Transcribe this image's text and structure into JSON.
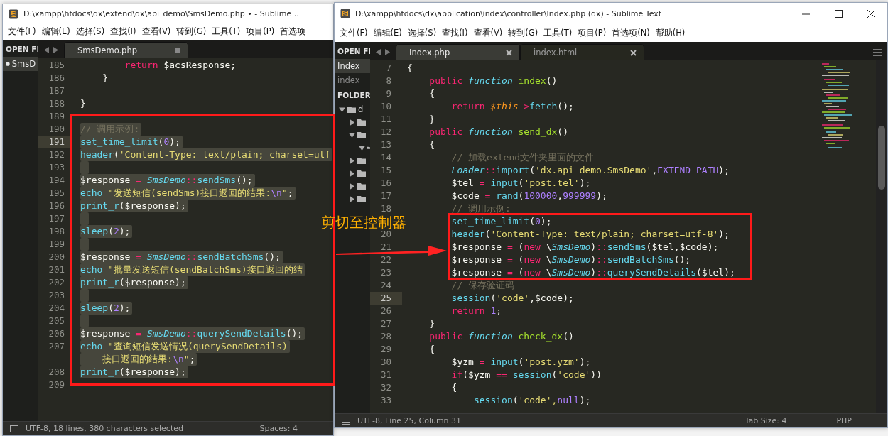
{
  "windows": [
    {
      "title": "D:\\xampp\\htdocs\\dx\\extend\\dx\\api_demo\\SmsDemo.php • - Sublime ...",
      "window_controls": false,
      "minimap": false,
      "menu": [
        "文件(F)",
        "编辑(E)",
        "选择(S)",
        "查找(I)",
        "查看(V)",
        "转到(G)",
        "工具(T)",
        "项目(P)",
        "首选项"
      ],
      "open_files": {
        "header": "OPEN FI",
        "items": [
          {
            "label": "SmsD",
            "selected": true,
            "dirty": true
          }
        ]
      },
      "tabs": [
        {
          "label": "SmsDemo.php",
          "selected": true,
          "dirty": true
        }
      ],
      "lines": [
        {
          "number": "185",
          "current": false,
          "selected": false,
          "tokens": [
            {
              "text": "        return ",
              "kind": "k"
            },
            {
              "text": "$acsResponse;",
              "kind": "p"
            }
          ]
        },
        {
          "number": "186",
          "current": false,
          "selected": false,
          "tokens": [
            {
              "text": "    }",
              "kind": "p"
            }
          ]
        },
        {
          "number": "187",
          "current": false,
          "selected": false
        },
        {
          "number": "188",
          "current": false,
          "selected": false,
          "tokens": [
            {
              "text": "}",
              "kind": "p"
            }
          ]
        },
        {
          "number": "189",
          "current": false,
          "selected": false
        },
        {
          "number": "190",
          "current": false,
          "selected": true,
          "tokens": [
            {
              "text": "// 调用示例:",
              "kind": "cm"
            }
          ]
        },
        {
          "number": "191",
          "current": true,
          "selected": true,
          "tokens": [
            {
              "text": "set_time_limit",
              "kind": "b"
            },
            {
              "text": "(",
              "kind": "p"
            },
            {
              "text": "0",
              "kind": "n"
            },
            {
              "text": ");",
              "kind": "p"
            }
          ]
        },
        {
          "number": "192",
          "current": false,
          "selected": true,
          "tokens": [
            {
              "text": "header",
              "kind": "b"
            },
            {
              "text": "(",
              "kind": "p"
            },
            {
              "text": "'Content-Type: text/plain; charset=utf",
              "kind": "st"
            }
          ]
        },
        {
          "number": "193",
          "current": false,
          "selected": true
        },
        {
          "number": "194",
          "current": false,
          "selected": true,
          "tokens": [
            {
              "text": "$response ",
              "kind": "p"
            },
            {
              "text": "= ",
              "kind": "o"
            },
            {
              "text": "SmsDemo",
              "kind": "c"
            },
            {
              "text": "::",
              "kind": "o"
            },
            {
              "text": "sendSms",
              "kind": "b"
            },
            {
              "text": "();",
              "kind": "p"
            }
          ]
        },
        {
          "number": "195",
          "current": false,
          "selected": true,
          "tokens": [
            {
              "text": "echo ",
              "kind": "b"
            },
            {
              "text": "\"发送短信(sendSms)接口返回的结果:",
              "kind": "st"
            },
            {
              "text": "\\n",
              "kind": "n"
            },
            {
              "text": "\"",
              "kind": "st"
            },
            {
              "text": ";",
              "kind": "p"
            }
          ]
        },
        {
          "number": "196",
          "current": false,
          "selected": true,
          "tokens": [
            {
              "text": "print_r",
              "kind": "b"
            },
            {
              "text": "($response);",
              "kind": "p"
            }
          ]
        },
        {
          "number": "197",
          "current": false,
          "selected": true
        },
        {
          "number": "198",
          "current": false,
          "selected": true,
          "tokens": [
            {
              "text": "sleep",
              "kind": "b"
            },
            {
              "text": "(",
              "kind": "p"
            },
            {
              "text": "2",
              "kind": "n"
            },
            {
              "text": ");",
              "kind": "p"
            }
          ]
        },
        {
          "number": "199",
          "current": false,
          "selected": true
        },
        {
          "number": "200",
          "current": false,
          "selected": true,
          "tokens": [
            {
              "text": "$response ",
              "kind": "p"
            },
            {
              "text": "= ",
              "kind": "o"
            },
            {
              "text": "SmsDemo",
              "kind": "c"
            },
            {
              "text": "::",
              "kind": "o"
            },
            {
              "text": "sendBatchSms",
              "kind": "b"
            },
            {
              "text": "();",
              "kind": "p"
            }
          ]
        },
        {
          "number": "201",
          "current": false,
          "selected": true,
          "tokens": [
            {
              "text": "echo ",
              "kind": "b"
            },
            {
              "text": "\"批量发送短信(sendBatchSms)接口返回的结",
              "kind": "st"
            }
          ]
        },
        {
          "number": "202",
          "current": false,
          "selected": true,
          "tokens": [
            {
              "text": "print_r",
              "kind": "b"
            },
            {
              "text": "($response);",
              "kind": "p"
            }
          ]
        },
        {
          "number": "203",
          "current": false,
          "selected": true
        },
        {
          "number": "204",
          "current": false,
          "selected": true,
          "tokens": [
            {
              "text": "sleep",
              "kind": "b"
            },
            {
              "text": "(",
              "kind": "p"
            },
            {
              "text": "2",
              "kind": "n"
            },
            {
              "text": ");",
              "kind": "p"
            }
          ]
        },
        {
          "number": "205",
          "current": false,
          "selected": true
        },
        {
          "number": "206",
          "current": false,
          "selected": true,
          "tokens": [
            {
              "text": "$response ",
              "kind": "p"
            },
            {
              "text": "= ",
              "kind": "o"
            },
            {
              "text": "SmsDemo",
              "kind": "c"
            },
            {
              "text": "::",
              "kind": "o"
            },
            {
              "text": "querySendDetails",
              "kind": "b"
            },
            {
              "text": "();",
              "kind": "p"
            }
          ]
        },
        {
          "number": "207",
          "current": false,
          "selected": true,
          "tokens": [
            {
              "text": "echo ",
              "kind": "b"
            },
            {
              "text": "\"查询短信发送情况(querySendDetails)",
              "kind": "st"
            }
          ],
          "continuation": [
            {
              "text": "    接口返回的结果:",
              "kind": "st"
            },
            {
              "text": "\\n",
              "kind": "n"
            },
            {
              "text": "\"",
              "kind": "st"
            },
            {
              "text": ";",
              "kind": "p"
            }
          ]
        },
        {
          "number": "208",
          "current": false,
          "selected": true,
          "tokens": [
            {
              "text": "print_r",
              "kind": "b"
            },
            {
              "text": "($response);",
              "kind": "p"
            }
          ]
        },
        {
          "number": "209",
          "current": false,
          "selected": false
        }
      ],
      "status": {
        "left": "UTF-8, 18 lines, 380 characters selected",
        "right": [
          "Spaces: 4"
        ]
      }
    },
    {
      "title": "D:\\xampp\\htdocs\\dx\\application\\index\\controller\\Index.php (dx) - Sublime Text",
      "window_controls": true,
      "minimap": true,
      "menu": [
        "文件(F)",
        "编辑(E)",
        "选择(S)",
        "查找(I)",
        "查看(V)",
        "转到(G)",
        "工具(T)",
        "项目(P)",
        "首选项(N)",
        "帮助(H)"
      ],
      "open_files": {
        "header": "OPEN FI",
        "items": [
          {
            "label": "Index",
            "selected": true,
            "dirty": false
          },
          {
            "label": "index",
            "selected": false,
            "dirty": false
          }
        ]
      },
      "folders": {
        "header": "FOLDER",
        "tree": [
          {
            "label": "d",
            "expanded": true,
            "children": [
              {
                "expanded": false
              },
              {
                "expanded": true,
                "children": [
                  {
                    "expanded": true
                  }
                ]
              },
              {
                "expanded": false
              },
              {
                "expanded": false
              },
              {
                "expanded": false
              },
              {
                "expanded": false
              }
            ]
          }
        ]
      },
      "tabs": [
        {
          "label": "Index.php",
          "selected": true,
          "dirty": false
        },
        {
          "label": "index.html",
          "selected": false,
          "dirty": false
        }
      ],
      "lines": [
        {
          "number": "7",
          "current": false,
          "selected": false,
          "tokens": [
            {
              "text": "{",
              "kind": "p"
            }
          ]
        },
        {
          "number": "8",
          "current": false,
          "selected": false,
          "tokens": [
            {
              "text": "    public ",
              "kind": "k"
            },
            {
              "text": "function ",
              "kind": "s"
            },
            {
              "text": "index",
              "kind": "f"
            },
            {
              "text": "()",
              "kind": "p"
            }
          ]
        },
        {
          "number": "9",
          "current": false,
          "selected": false,
          "tokens": [
            {
              "text": "    {",
              "kind": "p"
            }
          ]
        },
        {
          "number": "10",
          "current": false,
          "selected": false,
          "tokens": [
            {
              "text": "        return ",
              "kind": "k"
            },
            {
              "text": "$this",
              "kind": "v"
            },
            {
              "text": "->",
              "kind": "o"
            },
            {
              "text": "fetch",
              "kind": "b"
            },
            {
              "text": "();",
              "kind": "p"
            }
          ]
        },
        {
          "number": "11",
          "current": false,
          "selected": false,
          "tokens": [
            {
              "text": "    }",
              "kind": "p"
            }
          ]
        },
        {
          "number": "12",
          "current": false,
          "selected": false,
          "tokens": [
            {
              "text": "    public ",
              "kind": "k"
            },
            {
              "text": "function ",
              "kind": "s"
            },
            {
              "text": "send_dx",
              "kind": "f"
            },
            {
              "text": "()",
              "kind": "p"
            }
          ]
        },
        {
          "number": "13",
          "current": false,
          "selected": false,
          "tokens": [
            {
              "text": "    {",
              "kind": "p"
            }
          ]
        },
        {
          "number": "14",
          "current": false,
          "selected": false,
          "tokens": [
            {
              "text": "        // 加载extend文件夹里面的文件",
              "kind": "cm"
            }
          ]
        },
        {
          "number": "15",
          "current": false,
          "selected": false,
          "tokens": [
            {
              "text": "        Loader",
              "kind": "c"
            },
            {
              "text": "::",
              "kind": "o"
            },
            {
              "text": "import",
              "kind": "b"
            },
            {
              "text": "(",
              "kind": "p"
            },
            {
              "text": "'dx.api_demo.SmsDemo'",
              "kind": "st"
            },
            {
              "text": ",",
              "kind": "p"
            },
            {
              "text": "EXTEND_PATH",
              "kind": "n"
            },
            {
              "text": ");",
              "kind": "p"
            }
          ]
        },
        {
          "number": "16",
          "current": false,
          "selected": false,
          "tokens": [
            {
              "text": "        $tel ",
              "kind": "p"
            },
            {
              "text": "= ",
              "kind": "o"
            },
            {
              "text": "input",
              "kind": "b"
            },
            {
              "text": "(",
              "kind": "p"
            },
            {
              "text": "'post.tel'",
              "kind": "st"
            },
            {
              "text": ");",
              "kind": "p"
            }
          ]
        },
        {
          "number": "17",
          "current": false,
          "selected": false,
          "tokens": [
            {
              "text": "        $code ",
              "kind": "p"
            },
            {
              "text": "= ",
              "kind": "o"
            },
            {
              "text": "rand",
              "kind": "b"
            },
            {
              "text": "(",
              "kind": "p"
            },
            {
              "text": "100000",
              "kind": "n"
            },
            {
              "text": ",",
              "kind": "p"
            },
            {
              "text": "999999",
              "kind": "n"
            },
            {
              "text": ");",
              "kind": "p"
            }
          ]
        },
        {
          "number": "18",
          "current": false,
          "selected": false,
          "tokens": [
            {
              "text": "        // 调用示例:",
              "kind": "cm"
            }
          ]
        },
        {
          "current": false,
          "selected": false,
          "tokens": [
            {
              "text": "        set_time_limit",
              "kind": "b"
            },
            {
              "text": "(",
              "kind": "p"
            },
            {
              "text": "0",
              "kind": "n"
            },
            {
              "text": ");",
              "kind": "p"
            }
          ]
        },
        {
          "number": "20",
          "current": false,
          "selected": false,
          "tokens": [
            {
              "text": "        header",
              "kind": "b"
            },
            {
              "text": "(",
              "kind": "p"
            },
            {
              "text": "'Content-Type: text/plain; charset=utf-8'",
              "kind": "st"
            },
            {
              "text": ");",
              "kind": "p"
            }
          ]
        },
        {
          "number": "21",
          "current": false,
          "selected": false,
          "tokens": [
            {
              "text": "        $response ",
              "kind": "p"
            },
            {
              "text": "= ",
              "kind": "o"
            },
            {
              "text": "(",
              "kind": "p"
            },
            {
              "text": "new ",
              "kind": "k"
            },
            {
              "text": "\\",
              "kind": "p"
            },
            {
              "text": "SmsDemo",
              "kind": "c"
            },
            {
              "text": ")",
              "kind": "p"
            },
            {
              "text": "::",
              "kind": "o"
            },
            {
              "text": "sendSms",
              "kind": "b"
            },
            {
              "text": "($tel,$code);",
              "kind": "p"
            }
          ]
        },
        {
          "number": "22",
          "current": false,
          "selected": false,
          "tokens": [
            {
              "text": "        $response ",
              "kind": "p"
            },
            {
              "text": "= ",
              "kind": "o"
            },
            {
              "text": "(",
              "kind": "p"
            },
            {
              "text": "new ",
              "kind": "k"
            },
            {
              "text": "\\",
              "kind": "p"
            },
            {
              "text": "SmsDemo",
              "kind": "c"
            },
            {
              "text": ")",
              "kind": "p"
            },
            {
              "text": "::",
              "kind": "o"
            },
            {
              "text": "sendBatchSms",
              "kind": "b"
            },
            {
              "text": "();",
              "kind": "p"
            }
          ]
        },
        {
          "number": "23",
          "current": false,
          "selected": false,
          "tokens": [
            {
              "text": "        $response ",
              "kind": "p"
            },
            {
              "text": "= ",
              "kind": "o"
            },
            {
              "text": "(",
              "kind": "p"
            },
            {
              "text": "new ",
              "kind": "k"
            },
            {
              "text": "\\",
              "kind": "p"
            },
            {
              "text": "SmsDemo",
              "kind": "c"
            },
            {
              "text": ")",
              "kind": "p"
            },
            {
              "text": "::",
              "kind": "o"
            },
            {
              "text": "querySendDetails",
              "kind": "b"
            },
            {
              "text": "($tel);",
              "kind": "p"
            }
          ]
        },
        {
          "number": "24",
          "current": false,
          "selected": false,
          "tokens": [
            {
              "text": "        // 保存验证码",
              "kind": "cm"
            }
          ]
        },
        {
          "number": "25",
          "current": true,
          "selected": false,
          "tokens": [
            {
              "text": "        session",
              "kind": "b"
            },
            {
              "text": "(",
              "kind": "p"
            },
            {
              "text": "'code'",
              "kind": "st"
            },
            {
              "text": ",$code);",
              "kind": "p"
            }
          ]
        },
        {
          "number": "26",
          "current": false,
          "selected": false,
          "tokens": [
            {
              "text": "        return ",
              "kind": "k"
            },
            {
              "text": "1",
              "kind": "n"
            },
            {
              "text": ";",
              "kind": "p"
            }
          ]
        },
        {
          "number": "27",
          "current": false,
          "selected": false,
          "tokens": [
            {
              "text": "    }",
              "kind": "p"
            }
          ]
        },
        {
          "number": "28",
          "current": false,
          "selected": false,
          "tokens": [
            {
              "text": "    public ",
              "kind": "k"
            },
            {
              "text": "function ",
              "kind": "s"
            },
            {
              "text": "check_dx",
              "kind": "f"
            },
            {
              "text": "()",
              "kind": "p"
            }
          ]
        },
        {
          "number": "29",
          "current": false,
          "selected": false,
          "tokens": [
            {
              "text": "    {",
              "kind": "p"
            }
          ]
        },
        {
          "number": "30",
          "current": false,
          "selected": false,
          "tokens": [
            {
              "text": "        $yzm ",
              "kind": "p"
            },
            {
              "text": "= ",
              "kind": "o"
            },
            {
              "text": "input",
              "kind": "b"
            },
            {
              "text": "(",
              "kind": "p"
            },
            {
              "text": "'post.yzm'",
              "kind": "st"
            },
            {
              "text": ");",
              "kind": "p"
            }
          ]
        },
        {
          "number": "31",
          "current": false,
          "selected": false,
          "tokens": [
            {
              "text": "        if",
              "kind": "k"
            },
            {
              "text": "($yzm ",
              "kind": "p"
            },
            {
              "text": "== ",
              "kind": "o"
            },
            {
              "text": "session",
              "kind": "b"
            },
            {
              "text": "(",
              "kind": "p"
            },
            {
              "text": "'code'",
              "kind": "st"
            },
            {
              "text": "))",
              "kind": "p"
            }
          ]
        },
        {
          "number": "32",
          "current": false,
          "selected": false,
          "tokens": [
            {
              "text": "        {",
              "kind": "p"
            }
          ]
        },
        {
          "number": "33",
          "current": false,
          "selected": false,
          "tokens": [
            {
              "text": "            session",
              "kind": "b"
            },
            {
              "text": "(",
              "kind": "p"
            },
            {
              "text": "'code',",
              "kind": "st"
            },
            {
              "text": "null",
              "kind": "n"
            },
            {
              "text": ");",
              "kind": "p"
            }
          ]
        }
      ],
      "status": {
        "left": "UTF-8, Line 25, Column 31",
        "right": [
          "Tab Size: 4",
          "PHP"
        ]
      }
    }
  ],
  "annotation": {
    "label": "剪切至控制器"
  }
}
